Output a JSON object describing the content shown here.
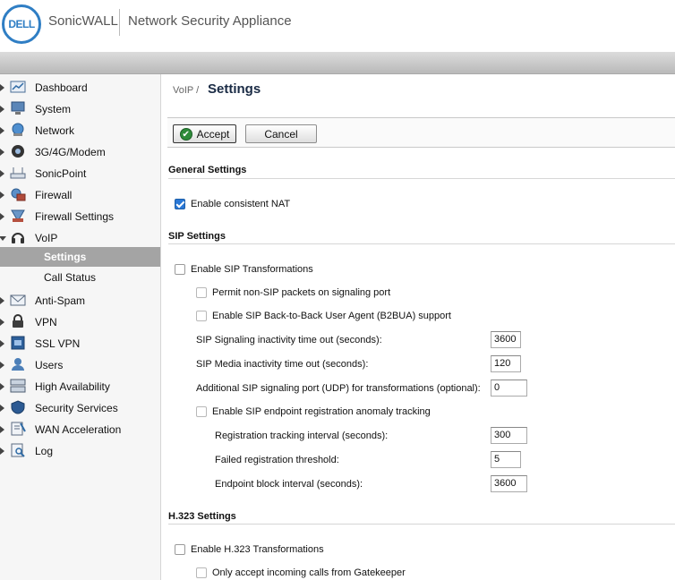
{
  "header": {
    "logo_text": "DELL",
    "brand": "SonicWALL",
    "product": "Network Security Appliance"
  },
  "sidebar": {
    "items": [
      {
        "label": "Dashboard",
        "icon": "dashboard-icon"
      },
      {
        "label": "System",
        "icon": "system-monitor-icon"
      },
      {
        "label": "Network",
        "icon": "network-globe-icon"
      },
      {
        "label": "3G/4G/Modem",
        "icon": "modem-icon"
      },
      {
        "label": "SonicPoint",
        "icon": "access-point-icon"
      },
      {
        "label": "Firewall",
        "icon": "firewall-icon"
      },
      {
        "label": "Firewall Settings",
        "icon": "firewall-settings-icon"
      },
      {
        "label": "VoIP",
        "icon": "headset-icon"
      },
      {
        "label": "Anti-Spam",
        "icon": "envelope-icon"
      },
      {
        "label": "VPN",
        "icon": "lock-icon"
      },
      {
        "label": "SSL VPN",
        "icon": "ssl-vpn-icon"
      },
      {
        "label": "Users",
        "icon": "users-icon"
      },
      {
        "label": "High Availability",
        "icon": "server-stack-icon"
      },
      {
        "label": "Security Services",
        "icon": "shield-icon"
      },
      {
        "label": "WAN Acceleration",
        "icon": "wan-acceleration-icon"
      },
      {
        "label": "Log",
        "icon": "log-search-icon"
      }
    ],
    "voip_subitems": [
      {
        "label": "Settings",
        "selected": true
      },
      {
        "label": "Call Status",
        "selected": false
      }
    ]
  },
  "main": {
    "breadcrumb": "VoIP /",
    "title": "Settings",
    "toolbar": {
      "accept_label": "Accept",
      "cancel_label": "Cancel"
    },
    "general": {
      "title": "General Settings",
      "consistent_nat_label": "Enable consistent NAT",
      "consistent_nat_checked": true
    },
    "sip": {
      "title": "SIP Settings",
      "enable_label": "Enable SIP Transformations",
      "permit_label": "Permit non-SIP packets on signaling port",
      "b2bua_label": "Enable SIP Back-to-Back User Agent (B2BUA) support",
      "signaling_timeout_label": "SIP Signaling inactivity time out (seconds):",
      "signaling_timeout_value": "3600",
      "media_timeout_label": "SIP Media inactivity time out (seconds):",
      "media_timeout_value": "120",
      "additional_port_label": "Additional SIP signaling port (UDP) for transformations (optional):",
      "additional_port_value": "0",
      "anomaly_label": "Enable SIP endpoint registration anomaly tracking",
      "reg_interval_label": "Registration tracking interval (seconds):",
      "reg_interval_value": "300",
      "failed_threshold_label": "Failed registration threshold:",
      "failed_threshold_value": "5",
      "block_interval_label": "Endpoint block interval (seconds):",
      "block_interval_value": "3600"
    },
    "h323": {
      "title": "H.323 Settings",
      "enable_label": "Enable H.323 Transformations",
      "gatekeeper_label": "Only accept incoming calls from Gatekeeper"
    }
  },
  "colors": {
    "accent": "#2a78d6",
    "selected_nav": "#a4a4a4",
    "accept_icon": "#2e8b3a"
  }
}
